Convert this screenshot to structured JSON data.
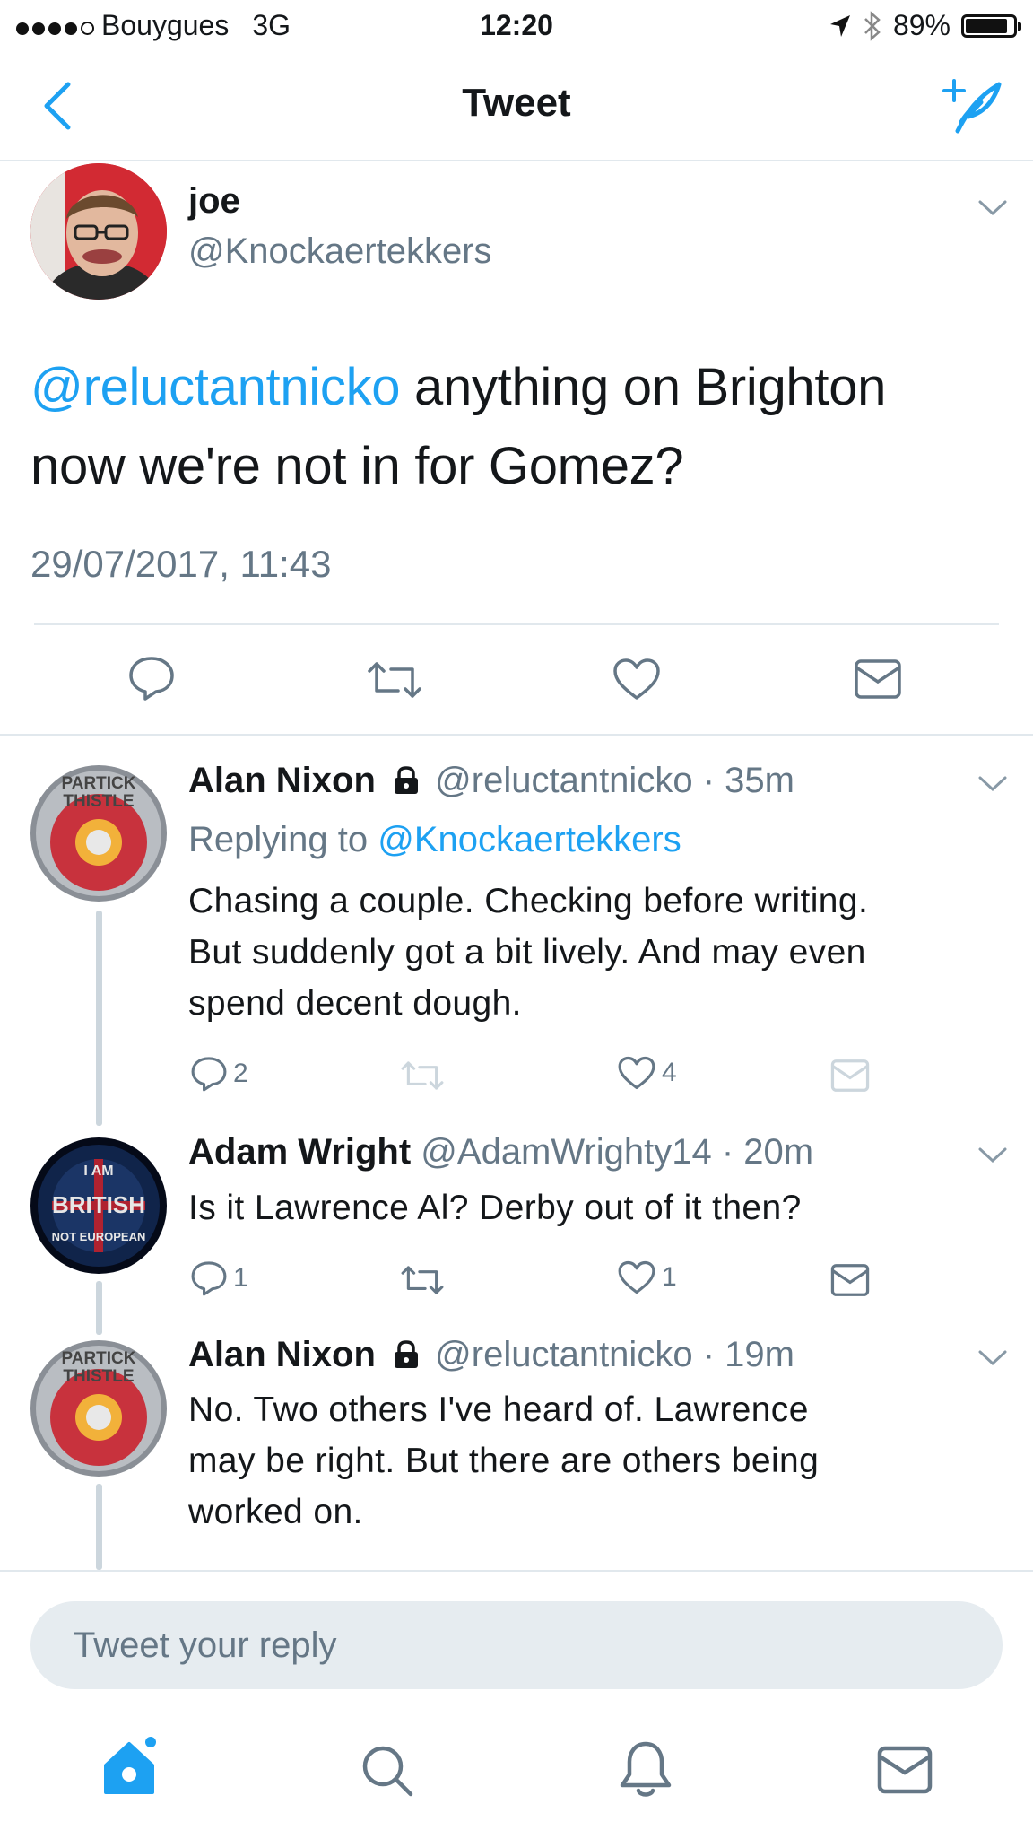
{
  "status_bar": {
    "carrier": "Bouygues",
    "network": "3G",
    "time": "12:20",
    "battery": "89%",
    "battery_level": 0.89
  },
  "nav": {
    "title": "Tweet"
  },
  "tweet": {
    "author_name": "joe",
    "author_handle": "@Knockaertekkers",
    "mention": "@reluctantnicko",
    "text_line1": " anything on Brighton",
    "text_line2": "now we're not in for Gomez?",
    "timestamp": "29/07/2017, 11:43"
  },
  "replies": [
    {
      "name": "Alan Nixon",
      "handle": "@reluctantnicko",
      "separator": "·",
      "time": "35m",
      "replying_prefix": "Replying to ",
      "replying_to": "@Knockaertekkers",
      "lines": [
        "Chasing a couple. Checking before writing.",
        "But suddenly got a bit lively. And may even",
        "spend decent dough."
      ],
      "reply_count": "2",
      "like_count": "4"
    },
    {
      "name": "Adam Wright",
      "handle": "@AdamWrighty14",
      "separator": "·",
      "time": "20m",
      "lines": [
        "Is it Lawrence Al? Derby out of it then?"
      ],
      "reply_count": "1",
      "like_count": "1"
    },
    {
      "name": "Alan Nixon",
      "handle": "@reluctantnicko",
      "separator": "·",
      "time": "19m",
      "lines": [
        "No. Two others I've heard of. Lawrence",
        "may be right. But there are others being",
        "worked on."
      ]
    }
  ],
  "avatar_text": {
    "partick_top": "PARTICK",
    "partick_bottom": "THISTLE",
    "british_top": "I AM",
    "british_mid": "BRITISH",
    "british_bottom": "NOT EUROPEAN"
  },
  "reply_bar": {
    "placeholder": "Tweet your reply"
  },
  "colors": {
    "accent": "#1da1f2",
    "secondary_text": "#657786",
    "divider": "#e1e8ed"
  },
  "icons": [
    "back-arrow-icon",
    "compose-tweet-icon",
    "reply-icon",
    "retweet-icon",
    "like-icon",
    "message-icon",
    "home-icon",
    "search-icon",
    "notifications-icon",
    "messages-icon",
    "lock-icon",
    "chevron-down-icon",
    "location-arrow-icon",
    "bluetooth-icon"
  ]
}
